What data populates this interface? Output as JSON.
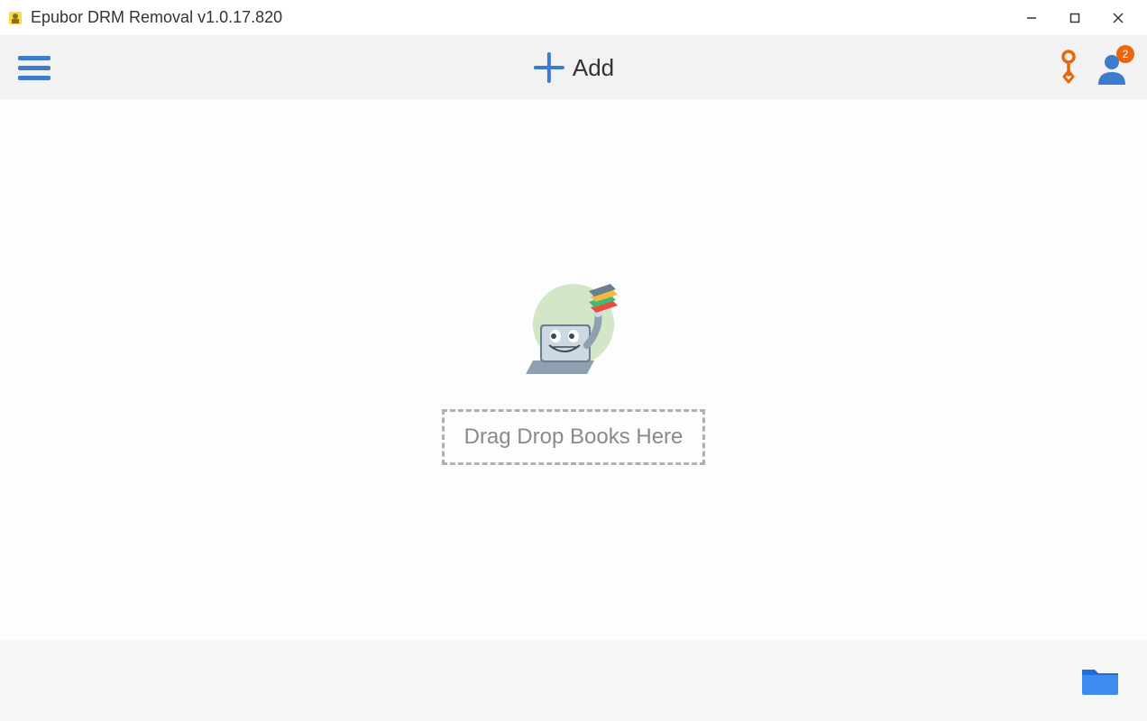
{
  "window": {
    "title": "Epubor DRM Removal v1.0.17.820"
  },
  "toolbar": {
    "add_label": "Add",
    "user_badge": "2"
  },
  "main": {
    "drop_text": "Drag Drop Books Here"
  },
  "colors": {
    "accent_blue": "#3d7bcc",
    "badge_orange": "#e8670a",
    "key_orange": "#e8670a"
  }
}
